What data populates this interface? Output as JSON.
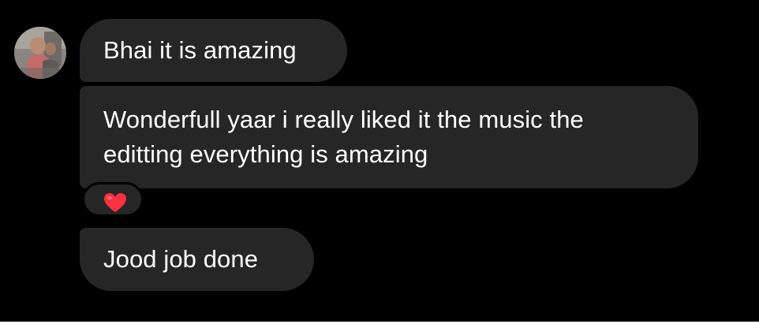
{
  "conversation": {
    "sender_avatar_icon": "user-avatar-photo",
    "messages": [
      {
        "text_lines": [
          "Bhai it is amazing"
        ]
      },
      {
        "text_lines": [
          "Wonderfull yaar i really liked it the music the",
          "editting everything is amazing"
        ],
        "reaction": "red-heart-icon"
      },
      {
        "text_lines": [
          "Jood job done"
        ]
      }
    ]
  },
  "colors": {
    "background": "#000000",
    "bubble": "#262626",
    "text": "#ffffff",
    "heart": "#ff3040"
  }
}
